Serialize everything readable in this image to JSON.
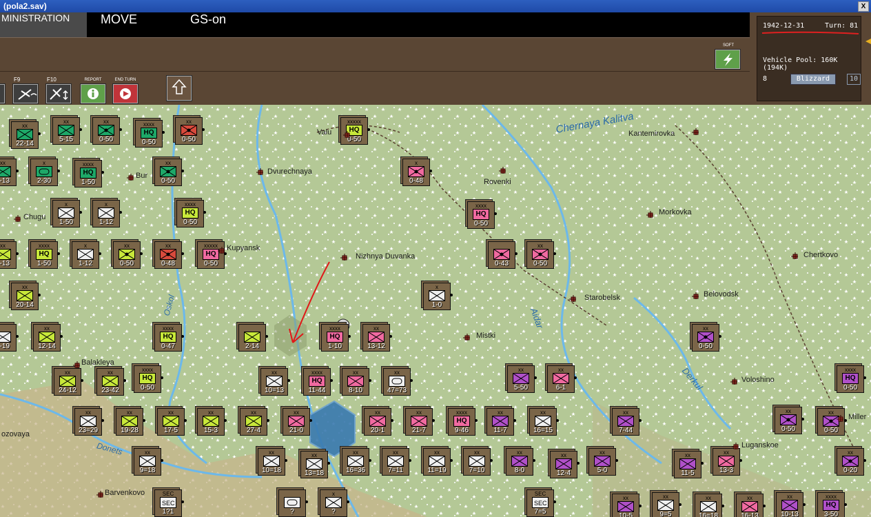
{
  "window": {
    "title": "(pola2.sav)",
    "close_label": "X"
  },
  "menu": {
    "tabs": [
      "MINISTRATION",
      "MOVE",
      "GS-on"
    ]
  },
  "toolbar": {
    "f9_label": "F9",
    "f10_label": "F10",
    "report_label": "REPORT",
    "end_turn_label": "END TURN",
    "soft_label": "SOFT"
  },
  "info": {
    "date": "1942-12-31",
    "turn": "Turn: 81",
    "vehicle_pool": "Vehicle Pool: 160K (194K)",
    "left_num": "8",
    "weather": "Blizzard",
    "weather_num": "10"
  },
  "cities": [
    {
      "name": "Valuyki",
      "display": "Valu"
    },
    {
      "name": "Dvurechnaya",
      "display": "Dvurechnaya"
    },
    {
      "name": "Rovenki",
      "display": "Rovenki"
    },
    {
      "name": "Kantemirovka",
      "display": "Kantemirovka"
    },
    {
      "name": "Morkovka",
      "display": "Morkovka"
    },
    {
      "name": "Kupyansk",
      "display": "Kupyansk"
    },
    {
      "name": "Nizhnya Duvanka",
      "display": "Nizhnya Duvanka"
    },
    {
      "name": "Chertkovo",
      "display": "Chertkovo"
    },
    {
      "name": "Starobelsk",
      "display": "Starobelsk"
    },
    {
      "name": "Belovodsk",
      "display": "Belovodsk"
    },
    {
      "name": "Mistki",
      "display": "Mistki"
    },
    {
      "name": "Voloshino",
      "display": "Voloshino"
    },
    {
      "name": "Chuguev",
      "display": "Chugu"
    },
    {
      "name": "Burluk",
      "display": "Bur"
    },
    {
      "name": "Balakleya",
      "display": "Balakleya"
    },
    {
      "name": "Lozovaya",
      "display": "ozovaya"
    },
    {
      "name": "Barvenkovo",
      "display": "Barvenkovo"
    },
    {
      "name": "Luganskoe",
      "display": "Luganskoe"
    },
    {
      "name": "Millerovo",
      "display": "Miller"
    }
  ],
  "rivers": [
    "Chernaya Kalitva",
    "Aidar",
    "Derkul",
    "Oskol",
    "Donets"
  ],
  "units": [
    {
      "size": "xx",
      "str": "22-14",
      "color": "#1ea868",
      "type": "inf"
    },
    {
      "size": "xx",
      "str": "5-15",
      "color": "#1ea868",
      "type": "inf"
    },
    {
      "size": "xx",
      "str": "0-50",
      "color": "#1ea868",
      "type": "arty"
    },
    {
      "size": "xxxx",
      "str": "0-50",
      "color": "#1ea868",
      "type": "hq"
    },
    {
      "size": "xx",
      "str": "0-50",
      "color": "#d84a3c",
      "type": "arty"
    },
    {
      "size": "xxxxx",
      "str": "0-50",
      "color": "#c8e83a",
      "type": "hq"
    },
    {
      "size": "x",
      "str": "2-30",
      "color": "#1ea868",
      "type": "tank"
    },
    {
      "size": "xxxx",
      "str": "1-50",
      "color": "#1ea868",
      "type": "hq"
    },
    {
      "size": "xx",
      "str": "0-50",
      "color": "#1ea868",
      "type": "arty"
    },
    {
      "size": "x",
      "str": "0-48",
      "color": "#f06aa0",
      "type": "arty"
    },
    {
      "size": "x",
      "str": "1-50",
      "color": "#f0f0f0",
      "type": "inf"
    },
    {
      "size": "x",
      "str": "1-12",
      "color": "#f0f0f0",
      "type": "inf"
    },
    {
      "size": "xxxx",
      "str": "0-50",
      "color": "#c8e83a",
      "type": "hq"
    },
    {
      "size": "xxxx",
      "str": "0-50",
      "color": "#f06aa0",
      "type": "hq"
    },
    {
      "size": "xxxx",
      "str": "1-50",
      "color": "#c8e83a",
      "type": "hq"
    },
    {
      "size": "x",
      "str": "1-12",
      "color": "#f0f0f0",
      "type": "inf"
    },
    {
      "size": "xx",
      "str": "0-50",
      "color": "#c8e83a",
      "type": "arty"
    },
    {
      "size": "xx",
      "str": "0-48",
      "color": "#d84a3c",
      "type": "arty"
    },
    {
      "size": "xxxxx",
      "str": "0-50",
      "color": "#f06aa0",
      "type": "hq"
    },
    {
      "size": "",
      "str": "0-43",
      "color": "#f06aa0",
      "type": "arty"
    },
    {
      "size": "xx",
      "str": "0-50",
      "color": "#f06aa0",
      "type": "arty"
    },
    {
      "size": "x",
      "str": "1-0",
      "color": "#f0f0f0",
      "type": "inf"
    },
    {
      "size": "xx",
      "str": "20-14",
      "color": "#c8e83a",
      "type": "inf"
    },
    {
      "size": "xx",
      "str": "12-14",
      "color": "#c8e83a",
      "type": "inf"
    },
    {
      "size": "xxxx",
      "str": "0-47",
      "color": "#c8e83a",
      "type": "hq"
    },
    {
      "size": "",
      "str": "2-14",
      "color": "#c8e83a",
      "type": "inf"
    },
    {
      "size": "xxxx",
      "str": "1-10",
      "color": "#f06aa0",
      "type": "hq"
    },
    {
      "size": "xx",
      "str": "13-12",
      "color": "#f06aa0",
      "type": "inf"
    },
    {
      "size": "xx",
      "str": "0-50",
      "color": "#b050c8",
      "type": "arty"
    },
    {
      "size": "xx",
      "str": "24-12",
      "color": "#c8e83a",
      "type": "inf"
    },
    {
      "size": "xx",
      "str": "23-42",
      "color": "#c8e83a",
      "type": "inf"
    },
    {
      "size": "xxxx",
      "str": "0-50",
      "color": "#c8e83a",
      "type": "hq"
    },
    {
      "size": "xx",
      "str": "10=13",
      "color": "#f0f0f0",
      "type": "inf"
    },
    {
      "size": "xxxx",
      "str": "11-44",
      "color": "#f06aa0",
      "type": "hq"
    },
    {
      "size": "xx",
      "str": "8-10",
      "color": "#f06aa0",
      "type": "inf"
    },
    {
      "size": "xx",
      "str": "47=73",
      "color": "#f0f0f0",
      "type": "tank"
    },
    {
      "size": "xx",
      "str": "5-50",
      "color": "#b050c8",
      "type": "inf"
    },
    {
      "size": "xx",
      "str": "6-1",
      "color": "#f06aa0",
      "type": "inf"
    },
    {
      "size": "xxxx",
      "str": "0-50",
      "color": "#b050c8",
      "type": "hq"
    },
    {
      "size": "xx",
      "str": "23=29",
      "color": "#f0f0f0",
      "type": "inf"
    },
    {
      "size": "xx",
      "str": "19-28",
      "color": "#c8e83a",
      "type": "inf"
    },
    {
      "size": "xx",
      "str": "17-5",
      "color": "#c8e83a",
      "type": "inf"
    },
    {
      "size": "xx",
      "str": "15-3",
      "color": "#c8e83a",
      "type": "inf"
    },
    {
      "size": "xx",
      "str": "27-4",
      "color": "#c8e83a",
      "type": "inf"
    },
    {
      "size": "xx",
      "str": "21-0",
      "color": "#f06aa0",
      "type": "inf"
    },
    {
      "size": "xx",
      "str": "20-1",
      "color": "#f06aa0",
      "type": "inf"
    },
    {
      "size": "xx",
      "str": "21-7",
      "color": "#f06aa0",
      "type": "inf"
    },
    {
      "size": "xxxx",
      "str": "9-46",
      "color": "#f06aa0",
      "type": "hq"
    },
    {
      "size": "xx",
      "str": "11-7",
      "color": "#b050c8",
      "type": "inf"
    },
    {
      "size": "xx",
      "str": "16=15",
      "color": "#f0f0f0",
      "type": "inf"
    },
    {
      "size": "xx",
      "str": "7-44",
      "color": "#b050c8",
      "type": "inf"
    },
    {
      "size": "xx",
      "str": "0-50",
      "color": "#b050c8",
      "type": "arty"
    },
    {
      "size": "xx",
      "str": "0-50",
      "color": "#b050c8",
      "type": "arty"
    },
    {
      "size": "xx",
      "str": "9=18",
      "color": "#f0f0f0",
      "type": "inf"
    },
    {
      "size": "xx",
      "str": "10=18",
      "color": "#f0f0f0",
      "type": "inf"
    },
    {
      "size": "xx",
      "str": "13=18",
      "color": "#f0f0f0",
      "type": "inf"
    },
    {
      "size": "xx",
      "str": "16=36",
      "color": "#f0f0f0",
      "type": "inf"
    },
    {
      "size": "xx",
      "str": "7=11",
      "color": "#f0f0f0",
      "type": "inf"
    },
    {
      "size": "xx",
      "str": "11=19",
      "color": "#f0f0f0",
      "type": "inf"
    },
    {
      "size": "xx",
      "str": "7=10",
      "color": "#f0f0f0",
      "type": "inf"
    },
    {
      "size": "xx",
      "str": "8-0",
      "color": "#b050c8",
      "type": "inf"
    },
    {
      "size": "xx",
      "str": "12-4",
      "color": "#b050c8",
      "type": "inf"
    },
    {
      "size": "xx",
      "str": "5-0",
      "color": "#b050c8",
      "type": "inf"
    },
    {
      "size": "xx",
      "str": "11-5",
      "color": "#b050c8",
      "type": "inf"
    },
    {
      "size": "xx",
      "str": "13-3",
      "color": "#f06aa0",
      "type": "inf"
    },
    {
      "size": "xx",
      "str": "0-20",
      "color": "#b050c8",
      "type": "arty"
    },
    {
      "size": "SEC",
      "str": "1?1",
      "color": "#f0f0f0",
      "type": "sec"
    },
    {
      "size": "",
      "str": "?",
      "color": "#f0f0f0",
      "type": "tank"
    },
    {
      "size": "x",
      "str": "?",
      "color": "#f0f0f0",
      "type": "inf"
    },
    {
      "size": "SEC",
      "str": "7=5",
      "color": "#f0f0f0",
      "type": "sec"
    },
    {
      "size": "xx",
      "str": "10-5",
      "color": "#b050c8",
      "type": "inf"
    },
    {
      "size": "xx",
      "str": "9=5",
      "color": "#f0f0f0",
      "type": "inf"
    },
    {
      "size": "xx",
      "str": "16=18",
      "color": "#f0f0f0",
      "type": "inf"
    },
    {
      "size": "xx",
      "str": "16-13",
      "color": "#f06aa0",
      "type": "inf"
    },
    {
      "size": "xx",
      "str": "10-13",
      "color": "#b050c8",
      "type": "inf"
    },
    {
      "size": "xxxx",
      "str": "3-50",
      "color": "#b050c8",
      "type": "hq"
    },
    {
      "size": "",
      "str": "0-19",
      "color": "#f0f0f0",
      "type": "inf"
    },
    {
      "size": "xx",
      "str": "1-13",
      "color": "#1ea868",
      "type": "inf"
    },
    {
      "size": "xx",
      "str": "6-13",
      "color": "#c8e83a",
      "type": "inf"
    }
  ]
}
